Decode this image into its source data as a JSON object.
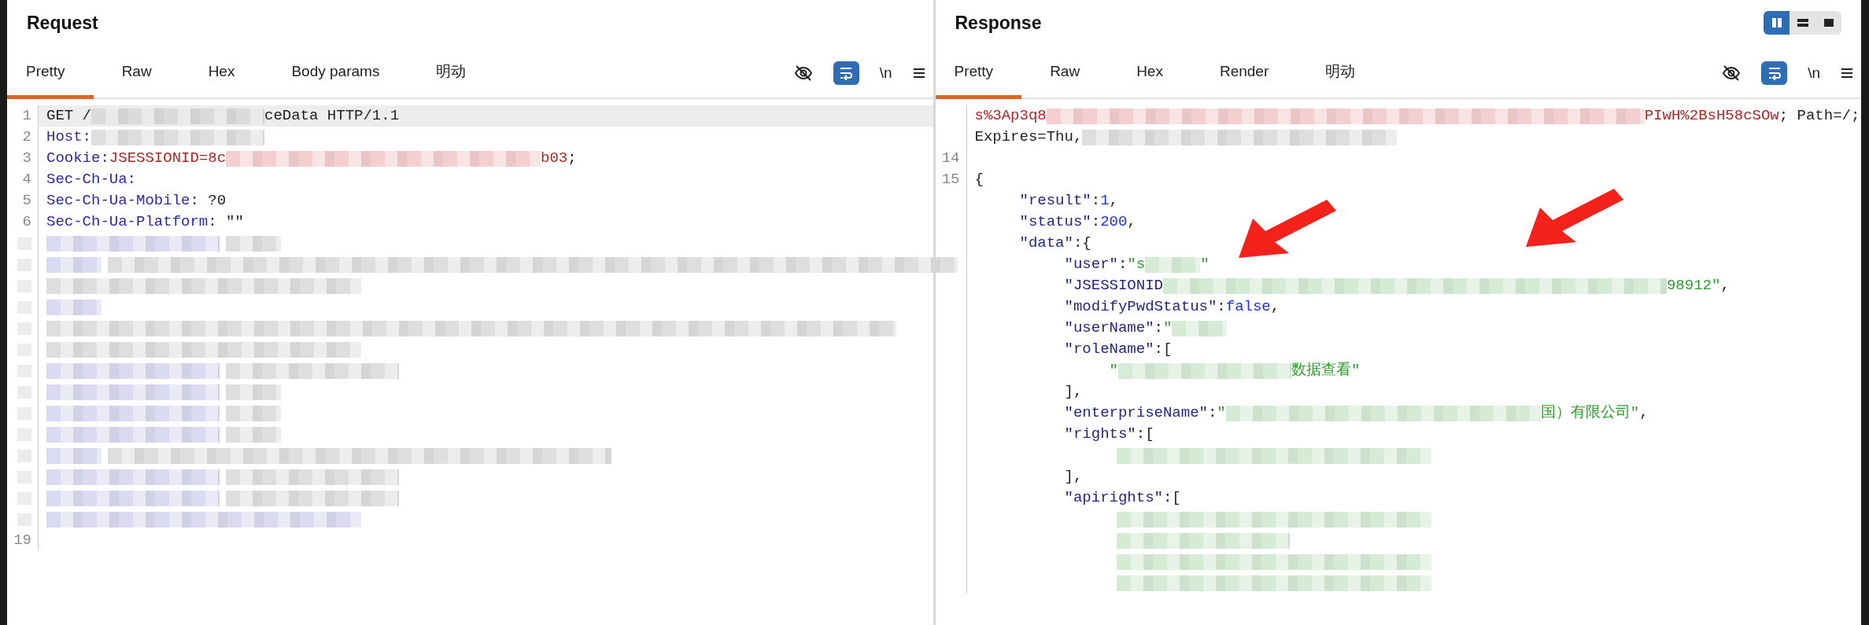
{
  "panes": [
    {
      "title": "Request",
      "tabs": [
        {
          "label": "Pretty",
          "selected": true
        },
        {
          "label": "Raw",
          "selected": false
        },
        {
          "label": "Hex",
          "selected": false
        },
        {
          "label": "Body params",
          "selected": false
        },
        {
          "label": "明动",
          "selected": false
        }
      ],
      "tools": {
        "wrap_on": true,
        "newline_label": "\\n"
      },
      "lines": [
        {
          "kind": "code",
          "number": "1",
          "highlighted": true,
          "segments": [
            {
              "kind": "plain",
              "text": "GET /"
            },
            {
              "kind": "shortblur",
              "color": "#d9d9d9"
            },
            {
              "kind": "plain",
              "text": "ceData HTTP/1.1"
            }
          ]
        },
        {
          "kind": "code",
          "number": "2",
          "segments": [
            {
              "kind": "name",
              "text": "Host:"
            },
            {
              "kind": "shortblur",
              "color": "#d9d9d9"
            }
          ]
        },
        {
          "kind": "code",
          "number": "3",
          "segments": [
            {
              "kind": "name",
              "text": "Cookie:"
            },
            {
              "kind": "value",
              "text": "JSESSIONID=8c"
            },
            {
              "kind": "midblur",
              "color": "#f1c7c7"
            },
            {
              "kind": "value",
              "text": "b03"
            },
            {
              "kind": "plain",
              "text": ";"
            }
          ]
        },
        {
          "kind": "code",
          "number": "4",
          "segments": [
            {
              "kind": "name",
              "text": "Sec-Ch-Ua:"
            }
          ]
        },
        {
          "kind": "code",
          "number": "5",
          "segments": [
            {
              "kind": "name",
              "text": "Sec-Ch-Ua-Mobile:"
            },
            {
              "kind": "plain",
              "text": " ?0"
            }
          ]
        },
        {
          "kind": "code",
          "number": "6",
          "segments": [
            {
              "kind": "name",
              "text": "Sec-Ch-Ua-Platform:"
            },
            {
              "kind": "plain",
              "text": " \"\""
            }
          ]
        },
        {
          "kind": "redacted",
          "nested": false,
          "bars": [
            {
              "kind": "shortblur",
              "color": "#d4d4ee"
            },
            {
              "kind": "tinyblur",
              "color": "#d9d9d9"
            }
          ]
        },
        {
          "kind": "redacted",
          "nested": false,
          "bars": [
            {
              "kind": "tinyblur",
              "color": "#d4d4ee"
            },
            {
              "kind": "fullblur",
              "color": "#d9d9d9"
            }
          ]
        },
        {
          "kind": "redacted",
          "nested": false,
          "bars": [
            {
              "kind": "midblur",
              "color": "#d9d9d9"
            }
          ]
        },
        {
          "kind": "redacted",
          "nested": false,
          "bars": [
            {
              "kind": "tinyblur",
              "color": "#d4d4ee"
            }
          ]
        },
        {
          "kind": "redacted",
          "nested": false,
          "bars": [
            {
              "kind": "fullblur",
              "color": "#d9d9d9"
            }
          ]
        },
        {
          "kind": "redacted",
          "nested": false,
          "bars": [
            {
              "kind": "midblur",
              "color": "#d9d9d9"
            }
          ]
        },
        {
          "kind": "redacted",
          "nested": false,
          "bars": [
            {
              "kind": "shortblur",
              "color": "#d4d4ee"
            },
            {
              "kind": "shortblur",
              "color": "#d9d9d9"
            }
          ]
        },
        {
          "kind": "redacted",
          "nested": false,
          "bars": [
            {
              "kind": "shortblur",
              "color": "#d4d4ee"
            },
            {
              "kind": "tinyblur",
              "color": "#d9d9d9"
            }
          ]
        },
        {
          "kind": "redacted",
          "nested": false,
          "bars": [
            {
              "kind": "shortblur",
              "color": "#d4d4ee"
            },
            {
              "kind": "tinyblur",
              "color": "#d9d9d9"
            }
          ]
        },
        {
          "kind": "redacted",
          "nested": false,
          "bars": [
            {
              "kind": "shortblur",
              "color": "#d4d4ee"
            },
            {
              "kind": "tinyblur",
              "color": "#d9d9d9"
            }
          ]
        },
        {
          "kind": "redacted",
          "nested": false,
          "bars": [
            {
              "kind": "tinyblur",
              "color": "#d4d4ee"
            },
            {
              "kind": "longblur",
              "color": "#d9d9d9"
            }
          ]
        },
        {
          "kind": "redacted",
          "nested": false,
          "bars": [
            {
              "kind": "shortblur",
              "color": "#d4d4ee"
            },
            {
              "kind": "shortblur",
              "color": "#d9d9d9"
            }
          ]
        },
        {
          "kind": "redacted",
          "nested": false,
          "bars": [
            {
              "kind": "shortblur",
              "color": "#d4d4ee"
            },
            {
              "kind": "shortblur",
              "color": "#d9d9d9"
            }
          ]
        },
        {
          "kind": "redacted",
          "nested": false,
          "bars": [
            {
              "kind": "midblur",
              "color": "#d4d4ee"
            }
          ]
        },
        {
          "kind": "code",
          "number": "19"
        }
      ]
    },
    {
      "title": "Response",
      "layout_toggle": [
        {
          "kind": "split",
          "selected": true
        },
        {
          "kind": "stacked",
          "selected": false
        },
        {
          "kind": "single",
          "selected": false
        }
      ],
      "tabs": [
        {
          "label": "Pretty",
          "selected": true
        },
        {
          "label": "Raw",
          "selected": false
        },
        {
          "label": "Hex",
          "selected": false
        },
        {
          "label": "Render",
          "selected": false
        },
        {
          "label": "明动",
          "selected": false
        }
      ],
      "tools": {
        "wrap_on": true,
        "newline_label": "\\n"
      },
      "lines": [
        {
          "kind": "code",
          "segments": [
            {
              "kind": "value",
              "text": "s%3Ap3q8"
            },
            {
              "kind": "wideblur",
              "color": "#f1c7c7"
            },
            {
              "kind": "value",
              "text": "PIwH%2BsH58cSOw"
            },
            {
              "kind": "plain",
              "text": "; Path=/;"
            }
          ]
        },
        {
          "kind": "code",
          "segments": [
            {
              "kind": "plain",
              "text": "Expires=Thu,"
            },
            {
              "kind": "midblur",
              "color": "#d9d9d9"
            }
          ]
        },
        {
          "kind": "code",
          "number": "14"
        },
        {
          "kind": "code",
          "number": "15",
          "segments": [
            {
              "kind": "plain",
              "text": "{"
            }
          ]
        },
        {
          "kind": "code",
          "segments": [
            {
              "kind": "key",
              "text": "     \"result\""
            },
            {
              "kind": "plain",
              "text": ":"
            },
            {
              "kind": "number",
              "text": "1"
            },
            {
              "kind": "plain",
              "text": ","
            }
          ]
        },
        {
          "kind": "code",
          "segments": [
            {
              "kind": "key",
              "text": "     \"status\""
            },
            {
              "kind": "plain",
              "text": ":"
            },
            {
              "kind": "number",
              "text": "200"
            },
            {
              "kind": "plain",
              "text": ","
            }
          ]
        },
        {
          "kind": "code",
          "segments": [
            {
              "kind": "key",
              "text": "     \"data\""
            },
            {
              "kind": "plain",
              "text": ":{"
            }
          ]
        },
        {
          "kind": "code",
          "segments": [
            {
              "kind": "key",
              "text": "          \"user\""
            },
            {
              "kind": "plain",
              "text": ":"
            },
            {
              "kind": "string",
              "text": "\"s"
            },
            {
              "kind": "tinyblur",
              "color": "#cfe8cf"
            },
            {
              "kind": "string",
              "text": "\""
            }
          ]
        },
        {
          "kind": "code",
          "segments": [
            {
              "kind": "key",
              "text": "          \"JSESSIONID"
            },
            {
              "kind": "longblur",
              "color": "#cfe8cf"
            },
            {
              "kind": "string",
              "text": "98912\""
            },
            {
              "kind": "plain",
              "text": ","
            }
          ]
        },
        {
          "kind": "code",
          "segments": [
            {
              "kind": "key",
              "text": "          \"modifyPwdStatus\""
            },
            {
              "kind": "plain",
              "text": ":"
            },
            {
              "kind": "number",
              "text": "false"
            },
            {
              "kind": "plain",
              "text": ","
            }
          ]
        },
        {
          "kind": "code",
          "segments": [
            {
              "kind": "key",
              "text": "          \"userName\""
            },
            {
              "kind": "plain",
              "text": ":"
            },
            {
              "kind": "string",
              "text": "\""
            },
            {
              "kind": "tinyblur",
              "color": "#cfe8cf"
            }
          ]
        },
        {
          "kind": "code",
          "segments": [
            {
              "kind": "key",
              "text": "          \"roleName\""
            },
            {
              "kind": "plain",
              "text": ":["
            }
          ]
        },
        {
          "kind": "code",
          "segments": [
            {
              "kind": "string",
              "text": "               \""
            },
            {
              "kind": "shortblur",
              "color": "#cfe8cf"
            },
            {
              "kind": "string",
              "text": "数据查看\""
            }
          ]
        },
        {
          "kind": "code",
          "segments": [
            {
              "kind": "plain",
              "text": "          ],"
            }
          ]
        },
        {
          "kind": "code",
          "segments": [
            {
              "kind": "key",
              "text": "          \"enterpriseName\""
            },
            {
              "kind": "plain",
              "text": ":"
            },
            {
              "kind": "string",
              "text": "\""
            },
            {
              "kind": "midblur",
              "color": "#cfe8cf"
            },
            {
              "kind": "string",
              "text": "国）有限公司\""
            },
            {
              "kind": "plain",
              "text": ","
            }
          ]
        },
        {
          "kind": "code",
          "segments": [
            {
              "kind": "key",
              "text": "          \"rights\""
            },
            {
              "kind": "plain",
              "text": ":["
            }
          ]
        },
        {
          "kind": "redacted",
          "nested": true,
          "bars": [
            {
              "kind": "midblur",
              "color": "#cfe8cf"
            }
          ]
        },
        {
          "kind": "code",
          "segments": [
            {
              "kind": "plain",
              "text": "          ],"
            }
          ]
        },
        {
          "kind": "code",
          "segments": [
            {
              "kind": "key",
              "text": "          \"apirights\""
            },
            {
              "kind": "plain",
              "text": ":["
            }
          ]
        },
        {
          "kind": "redacted",
          "nested": true,
          "bars": [
            {
              "kind": "midblur",
              "color": "#cfe8cf"
            }
          ]
        },
        {
          "kind": "redacted",
          "nested": true,
          "bars": [
            {
              "kind": "shortblur",
              "color": "#cfe8cf"
            }
          ]
        },
        {
          "kind": "redacted",
          "nested": true,
          "bars": [
            {
              "kind": "midblur",
              "color": "#cfe8cf"
            }
          ]
        },
        {
          "kind": "redacted",
          "nested": true,
          "bars": [
            {
              "kind": "midblur",
              "color": "#cfe8cf"
            }
          ]
        }
      ],
      "annotations": [
        {
          "kind": "arrow"
        },
        {
          "kind": "arrow"
        }
      ]
    }
  ]
}
